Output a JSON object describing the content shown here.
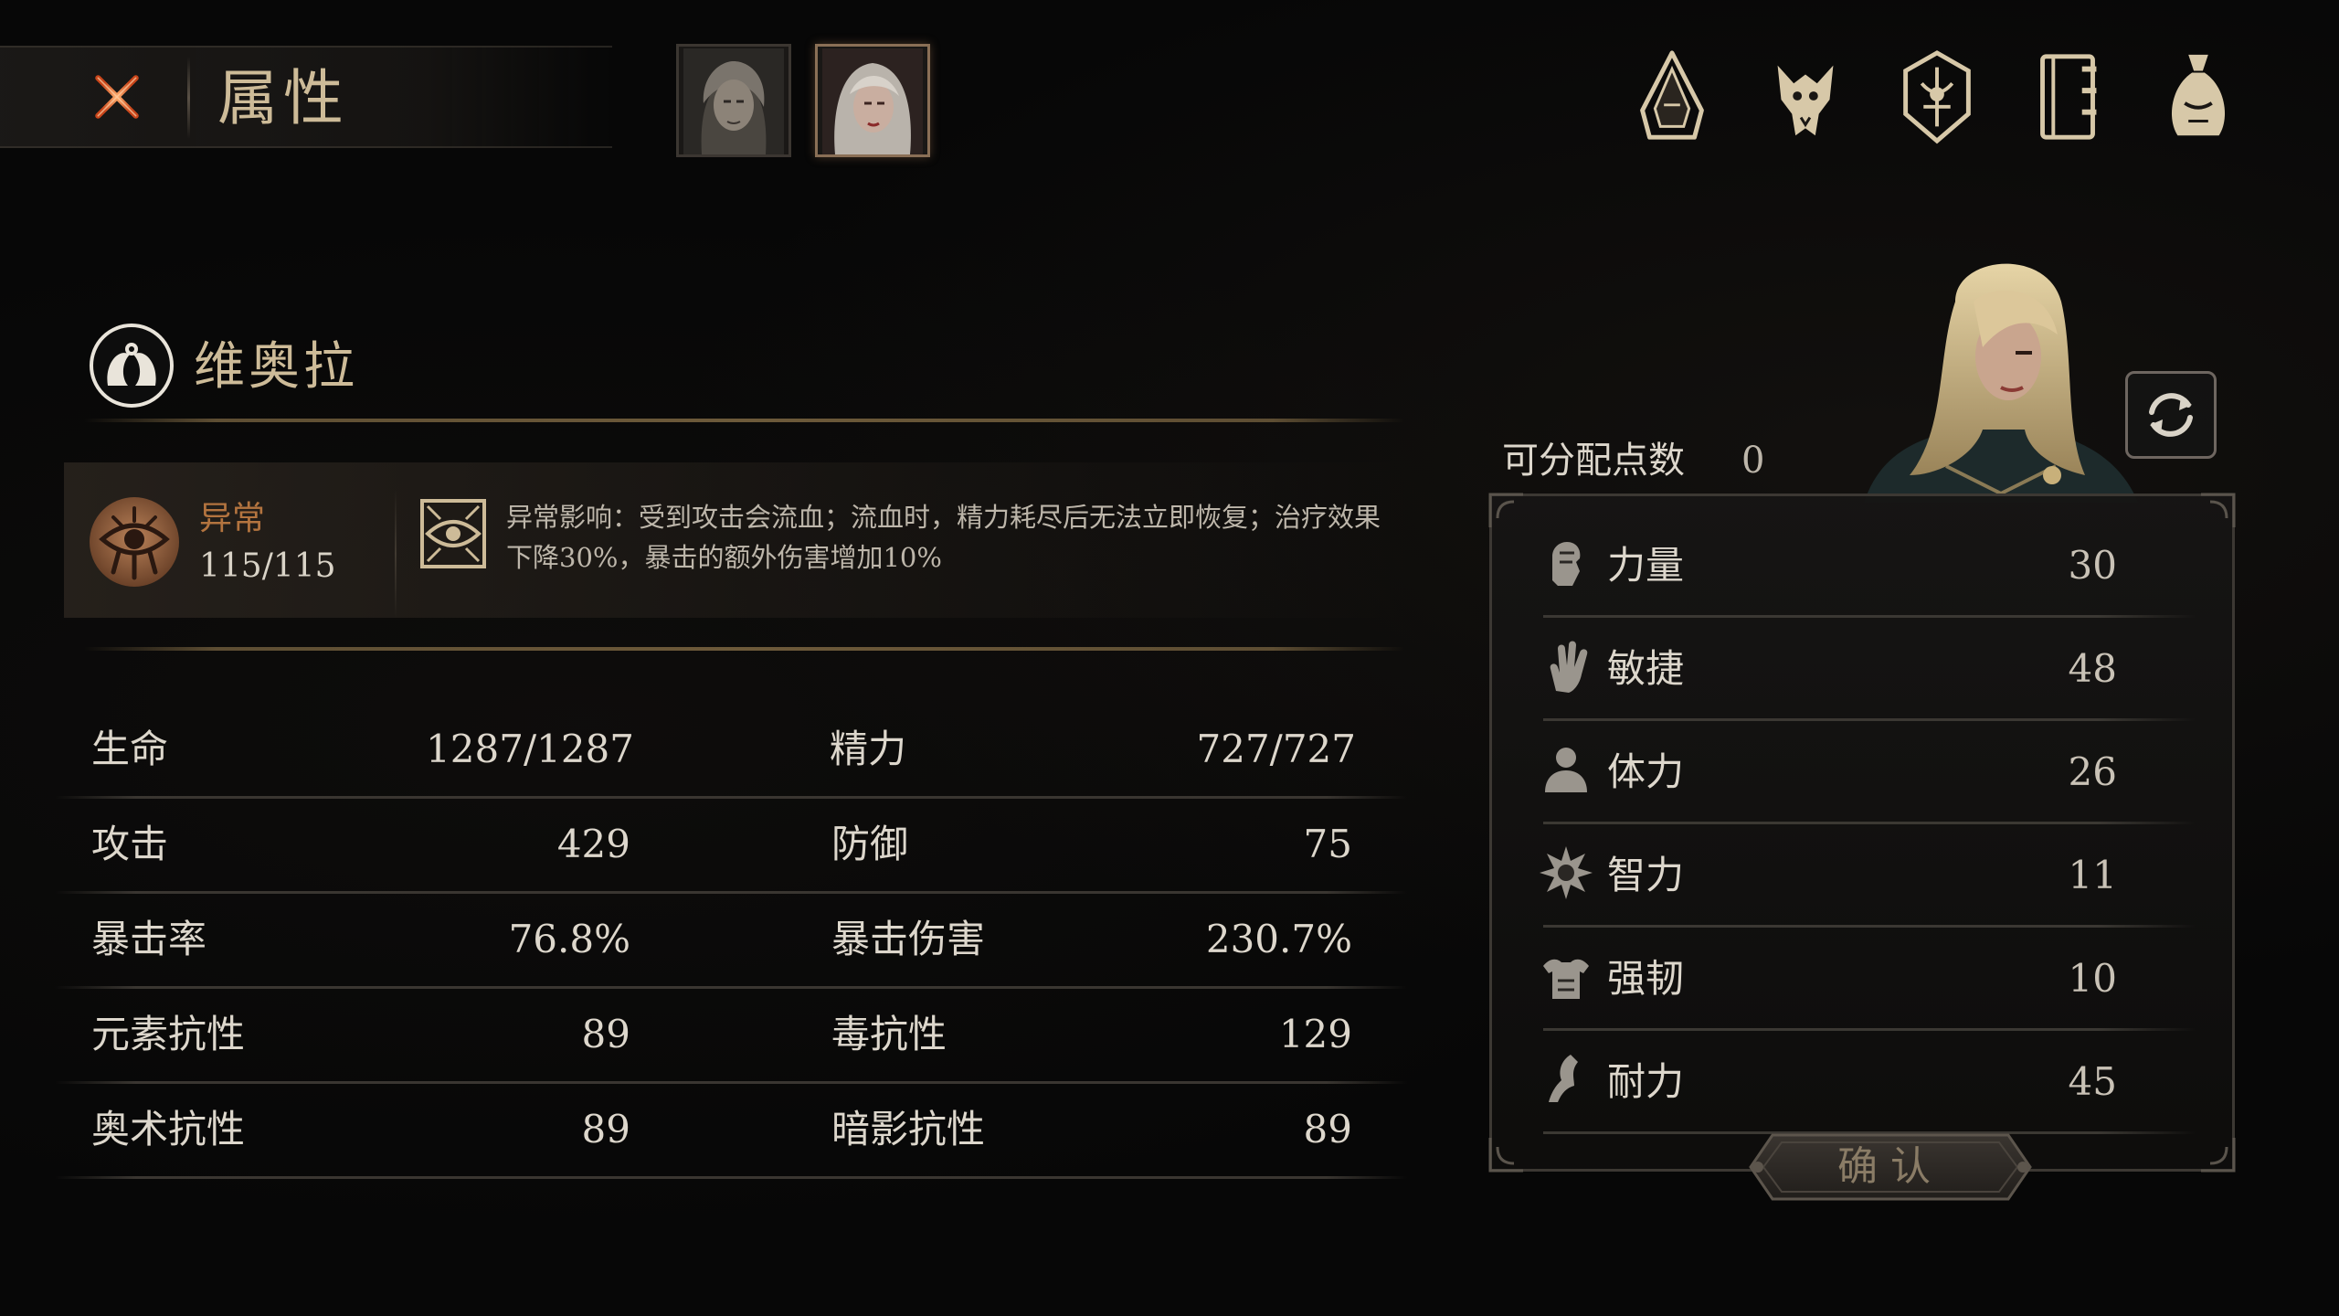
{
  "header": {
    "title": "属性",
    "close_icon": "close-x-icon",
    "portraits": [
      {
        "name": "male-character-portrait",
        "active": false
      },
      {
        "name": "female-character-portrait",
        "active": true
      }
    ],
    "nav_icons": [
      "hood-icon",
      "beast-skull-icon",
      "shield-crest-icon",
      "book-icon",
      "loot-bag-icon"
    ]
  },
  "character": {
    "name": "维奥拉",
    "emblem": "twin-serpent-emblem-icon"
  },
  "status": {
    "label": "异常",
    "value": "115/115",
    "icon": "bleeding-eye-emblem-icon",
    "effect_icon": "eye-sigil-icon",
    "description": "异常影响：受到攻击会流血；流血时，精力耗尽后无法立即恢复；治疗效果下降30%，暴击的额外伤害增加10%"
  },
  "stats": [
    {
      "left_label": "生命",
      "left_value": "1287/1287",
      "right_label": "精力",
      "right_value": "727/727"
    },
    {
      "left_label": "攻击",
      "left_value": "429",
      "right_label": "防御",
      "right_value": "75"
    },
    {
      "left_label": "暴击率",
      "left_value": "76.8%",
      "right_label": "暴击伤害",
      "right_value": "230.7%"
    },
    {
      "left_label": "元素抗性",
      "left_value": "89",
      "right_label": "毒抗性",
      "right_value": "129"
    },
    {
      "left_label": "奥术抗性",
      "left_value": "89",
      "right_label": "暗影抗性",
      "right_value": "89"
    }
  ],
  "attributes": {
    "points_label": "可分配点数",
    "points_value": "0",
    "refresh_icon": "refresh-icon",
    "items": [
      {
        "label": "力量",
        "value": "30",
        "icon": "fist-icon"
      },
      {
        "label": "敏捷",
        "value": "48",
        "icon": "open-hand-icon"
      },
      {
        "label": "体力",
        "value": "26",
        "icon": "body-icon"
      },
      {
        "label": "智力",
        "value": "11",
        "icon": "mind-burst-icon"
      },
      {
        "label": "强韧",
        "value": "10",
        "icon": "armor-icon"
      },
      {
        "label": "耐力",
        "value": "45",
        "icon": "runner-icon"
      }
    ],
    "confirm_label": "确认"
  },
  "colors": {
    "gold_text": "#cdbb98",
    "status_orange": "#b3743f",
    "close_orange": "#e2652a",
    "text_light": "#ddd7cc"
  }
}
